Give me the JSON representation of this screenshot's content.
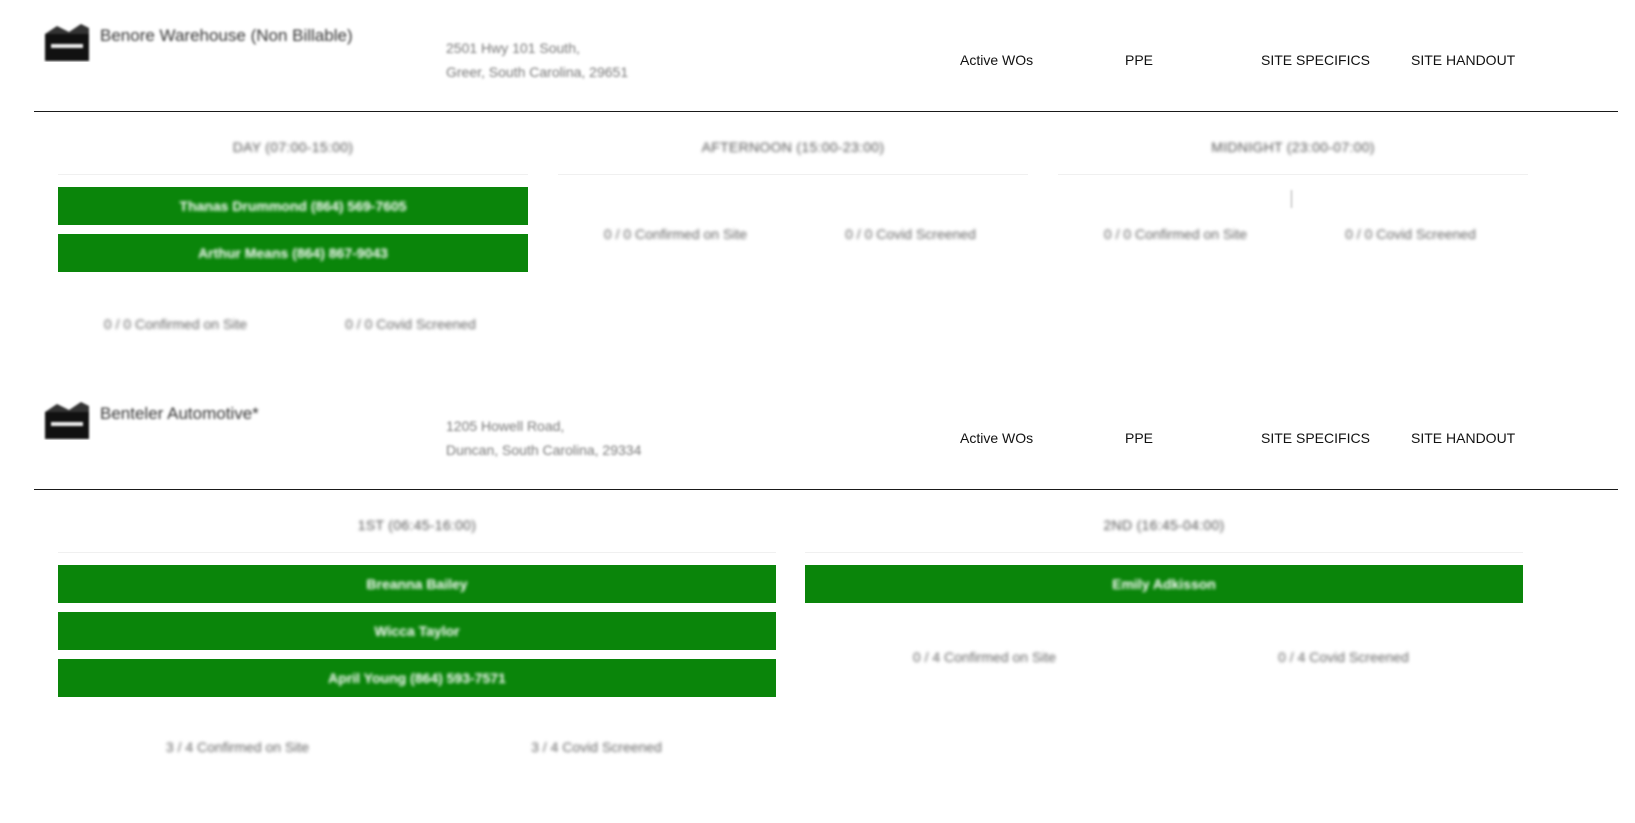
{
  "sites": [
    {
      "name": "Benore Warehouse (Non Billable)",
      "address_line1": "2501 Hwy 101 South,",
      "address_line2": "Greer, South Carolina, 29651",
      "links": {
        "active_wos": "Active WOs",
        "ppe": "PPE",
        "site_specifics": "SITE SPECIFICS",
        "site_handout": "SITE HANDOUT"
      },
      "shifts": [
        {
          "title": "DAY (07:00-15:00)",
          "techs": [
            "Thanas Drummond (864) 569-7605",
            "Arthur Means (864) 867-9043"
          ],
          "confirmed": "0 / 0 Confirmed on Site",
          "covid": "0 / 0 Covid Screened"
        },
        {
          "title": "AFTERNOON (15:00-23:00)",
          "techs": [],
          "confirmed": "0 / 0 Confirmed on Site",
          "covid": "0 / 0 Covid Screened"
        },
        {
          "title": "MIDNIGHT (23:00-07:00)",
          "techs": [],
          "confirmed": "0 / 0 Confirmed on Site",
          "covid": "0 / 0 Covid Screened"
        }
      ]
    },
    {
      "name": "Benteler Automotive*",
      "address_line1": "1205 Howell Road,",
      "address_line2": "Duncan, South Carolina, 29334",
      "links": {
        "active_wos": "Active WOs",
        "ppe": "PPE",
        "site_specifics": "SITE SPECIFICS",
        "site_handout": "SITE HANDOUT"
      },
      "shifts": [
        {
          "title": "1ST (06:45-16:00)",
          "techs": [
            "Breanna Bailey",
            "Wicca Taylor",
            "April Young (864) 593-7571"
          ],
          "confirmed": "3 / 4 Confirmed on Site",
          "covid": "3 / 4 Covid Screened"
        },
        {
          "title": "2ND (16:45-04:00)",
          "techs": [
            "Emily Adkisson"
          ],
          "confirmed": "0 / 4 Confirmed on Site",
          "covid": "0 / 4 Covid Screened"
        }
      ]
    }
  ],
  "colors": {
    "tech_button": "#0a850a",
    "divider": "#1a1a1a"
  },
  "icons": {
    "site": "building-icon"
  }
}
